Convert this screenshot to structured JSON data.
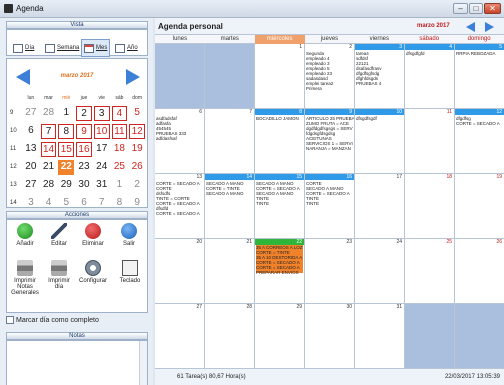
{
  "window": {
    "title": "Agenda",
    "minimize": "–",
    "maximize": "□",
    "close": "✕"
  },
  "vista": {
    "title": "Vista",
    "buttons": [
      {
        "label": "Día"
      },
      {
        "label": "Semana"
      },
      {
        "label": "Mes"
      },
      {
        "label": "Año"
      }
    ]
  },
  "mini_calendar": {
    "month": "marzo 2017",
    "dow": [
      "lun",
      "mar",
      "mié",
      "jue",
      "vie",
      "sáb",
      "dom"
    ],
    "weeks": [
      {
        "wk": "9",
        "days": [
          "27",
          "28",
          "1",
          "2",
          "3",
          "4",
          "5"
        ]
      },
      {
        "wk": "10",
        "days": [
          "6",
          "7",
          "8",
          "9",
          "10",
          "11",
          "12"
        ]
      },
      {
        "wk": "11",
        "days": [
          "13",
          "14",
          "15",
          "16",
          "17",
          "18",
          "19"
        ]
      },
      {
        "wk": "12",
        "days": [
          "20",
          "21",
          "22",
          "23",
          "24",
          "25",
          "26"
        ]
      },
      {
        "wk": "13",
        "days": [
          "27",
          "28",
          "29",
          "30",
          "31",
          "1",
          "2"
        ]
      },
      {
        "wk": "14",
        "days": [
          "3",
          "4",
          "5",
          "6",
          "7",
          "8",
          "9"
        ]
      }
    ]
  },
  "acciones": {
    "title": "Acciones",
    "buttons": [
      {
        "label": "Añadir"
      },
      {
        "label": "Editar"
      },
      {
        "label": "Eliminar"
      },
      {
        "label": "Salir"
      },
      {
        "label": "Imprimir Notas Generales"
      },
      {
        "label": "Imprimir día"
      },
      {
        "label": "Configurar"
      },
      {
        "label": "Teclado"
      }
    ],
    "checkbox_label": "Marcar día como completo"
  },
  "notas": {
    "title": "Notas"
  },
  "main": {
    "title": "Agenda personal",
    "month": "marzo 2017",
    "dow": [
      "lunes",
      "martes",
      "miércoles",
      "jueves",
      "viernes",
      "sábado",
      "domingo"
    ]
  },
  "cells": [
    {
      "num": "",
      "tasks": ""
    },
    {
      "num": "",
      "tasks": ""
    },
    {
      "num": "1",
      "tasks": ""
    },
    {
      "num": "2",
      "tasks": "Segunda\nempleado 4\nempleado 3\nempleado 5\nempleado 23\nsadasdasd\nemplei tarea2\nPrimera"
    },
    {
      "num": "3",
      "tasks": "tarea4\nsdfdsf\n22121\ndsafasdfrasv\ndfgdfsgfsdg\ndfghfdsgds\nPRUEBAS 4"
    },
    {
      "num": "4",
      "tasks": "dfsgdfgfd"
    },
    {
      "num": "5",
      "tasks": "RRPIA REBOZADA"
    },
    {
      "num": "6",
      "tasks": "asdfadsfaf\nadfasfa\n454545\nPRUEBAS 333\nadfdasfsaf"
    },
    {
      "num": "7",
      "tasks": ""
    },
    {
      "num": "8",
      "tasks": "BOCADILLO JAMON"
    },
    {
      "num": "9",
      "tasks": "ARTICULO 25 PRUEBA\nZUMO FRUTA = ACE\ndgdfdgdfsgsgs = SERV\nfdgdsgfdsgdsg\nACEITUNAS\nSERVICIOS 1 = SERVI\nNARANJA = MANZAN"
    },
    {
      "num": "10",
      "tasks": "dfsgdfsgdf"
    },
    {
      "num": "11",
      "tasks": ""
    },
    {
      "num": "12",
      "tasks": "dfgdfsg\nCORTE = SECADO A"
    },
    {
      "num": "13",
      "tasks": "CORTE = SECADO A\nCORTE\ndsfsdfs\nTINTE = CORTE\nCORTE = SECADO A\ndfsdfd\nCORTE = SECADO A"
    },
    {
      "num": "14",
      "tasks": "SECADO A MANO\nCORTE = TINTE\nSECADO A MANO"
    },
    {
      "num": "15",
      "tasks": "SECADO A MANO\nCORTE = SECADO A\nSECADO A MANO\nTINTE\nTINTE"
    },
    {
      "num": "16",
      "tasks": "CORTE\nSECADO A MANO\nCORTE = SECADO A\nTINTE\nTINTE"
    },
    {
      "num": "17",
      "tasks": ""
    },
    {
      "num": "18",
      "tasks": ""
    },
    {
      "num": "19",
      "tasks": ""
    },
    {
      "num": "20",
      "tasks": ""
    },
    {
      "num": "21",
      "tasks": ""
    },
    {
      "num": "22",
      "tasks": "35 A CORREOS A LOZ\nCORTE = TINTE\n35 A 10 DESTORIDA A\nCORTE = SECADO A\nCORTE = SECADO A\nPREPARAR ENVIOS"
    },
    {
      "num": "23",
      "tasks": ""
    },
    {
      "num": "24",
      "tasks": ""
    },
    {
      "num": "25",
      "tasks": ""
    },
    {
      "num": "26",
      "tasks": ""
    },
    {
      "num": "27",
      "tasks": ""
    },
    {
      "num": "28",
      "tasks": ""
    },
    {
      "num": "29",
      "tasks": ""
    },
    {
      "num": "30",
      "tasks": ""
    },
    {
      "num": "31",
      "tasks": ""
    },
    {
      "num": "",
      "tasks": ""
    },
    {
      "num": "",
      "tasks": ""
    }
  ],
  "status": {
    "left": "61 Tarea(s) 80,67 Hora(s)",
    "right": "22/03/2017  13:05:39"
  }
}
